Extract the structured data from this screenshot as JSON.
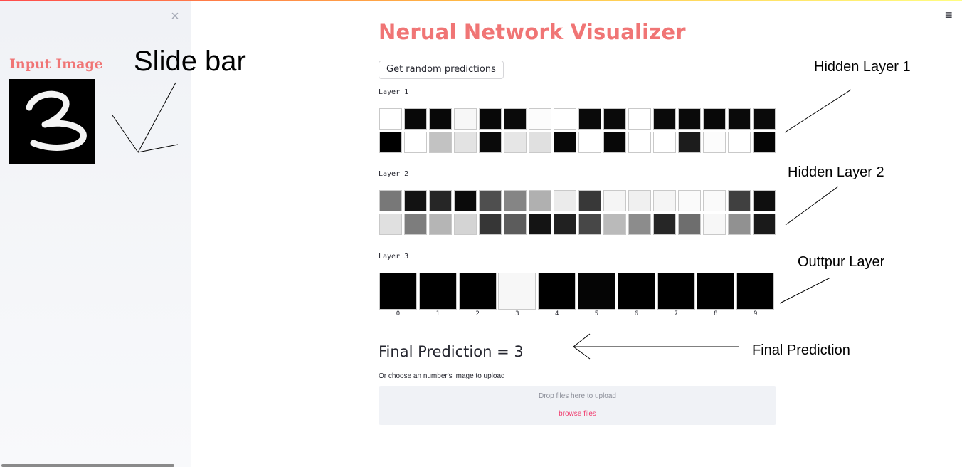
{
  "sidebar": {
    "close_icon": "close-icon",
    "title": "Input Image",
    "input_image": {
      "description_icon": "digit-image",
      "digit": "3"
    }
  },
  "header": {
    "menu_icon": "hamburger-menu-icon",
    "menu_glyph": "≡"
  },
  "main": {
    "title": "Nerual Network Visualizer",
    "random_button_label": "Get random predictions",
    "layers": [
      {
        "label": "Layer 1",
        "rows": [
          [
            1.0,
            0.03,
            0.03,
            0.97,
            0.03,
            0.04,
            0.99,
            1.0,
            0.04,
            0.04,
            1.0,
            0.04,
            0.04,
            0.03,
            0.04,
            0.04
          ],
          [
            0.0,
            1.0,
            0.76,
            0.89,
            0.04,
            0.9,
            0.88,
            0.03,
            1.0,
            0.03,
            1.0,
            1.0,
            0.11,
            0.99,
            1.0,
            0.02
          ]
        ]
      },
      {
        "label": "Layer 2",
        "rows": [
          [
            0.47,
            0.07,
            0.15,
            0.04,
            0.31,
            0.52,
            0.69,
            0.92,
            0.22,
            0.96,
            0.94,
            0.96,
            0.98,
            0.98,
            0.25,
            0.06
          ],
          [
            0.88,
            0.49,
            0.71,
            0.83,
            0.21,
            0.36,
            0.08,
            0.13,
            0.28,
            0.73,
            0.55,
            0.15,
            0.43,
            0.97,
            0.57,
            0.1
          ]
        ]
      },
      {
        "label": "Layer 3",
        "values": [
          0.0,
          0.0,
          0.0,
          0.97,
          0.0,
          0.02,
          0.0,
          0.0,
          0.0,
          0.0
        ],
        "labels": [
          "0",
          "1",
          "2",
          "3",
          "4",
          "5",
          "6",
          "7",
          "8",
          "9"
        ]
      }
    ],
    "final_prediction": "Final Prediction = 3",
    "upload_label": "Or choose an number's image to upload",
    "drop_text": "Drop files here to upload",
    "browse_label": "browse files"
  },
  "annotations": {
    "slide_bar": "Slide bar",
    "hidden_layer_1": "Hidden Layer 1",
    "hidden_layer_2": "Hidden Layer 2",
    "output_layer": "Outtpur Layer",
    "final_prediction": "Final Prediction"
  },
  "colors": {
    "accent": "#f07575",
    "link": "#f03c6e",
    "sidebar_bg": "#f0f2f6"
  }
}
